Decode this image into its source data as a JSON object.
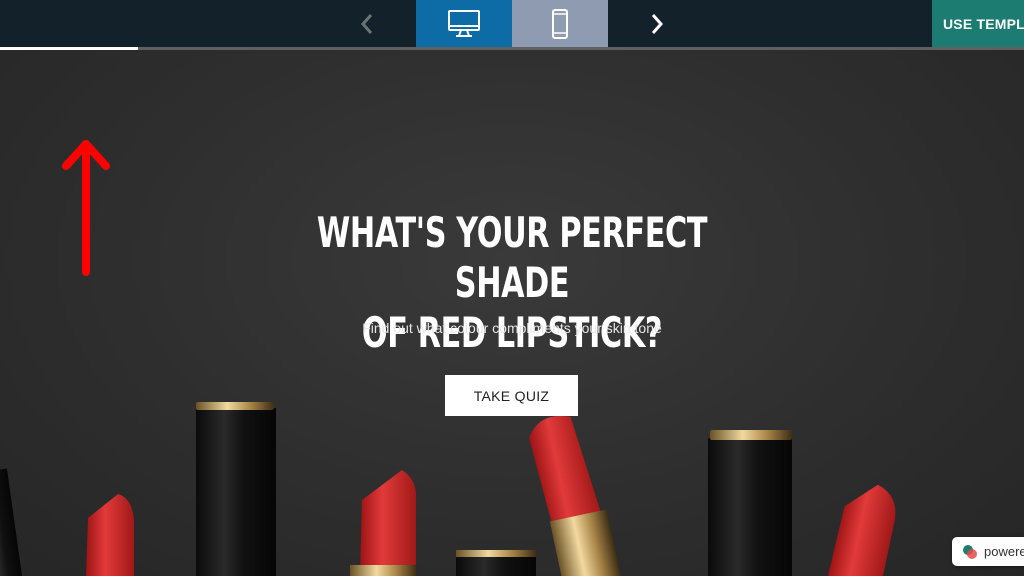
{
  "topbar": {
    "prev_icon": "chevron-left-icon",
    "next_icon": "chevron-right-icon",
    "desktop_icon": "desktop-monitor-icon",
    "mobile_icon": "mobile-phone-icon",
    "use_template_label": "USE TEMPLATE",
    "colors": {
      "bar": "#13212a",
      "desktop_active": "#0d6ca5",
      "mobile": "#8e9bb0",
      "use_template": "#1c7c72"
    }
  },
  "progress": {
    "value": 0.135
  },
  "hero": {
    "headline": "WHAT'S YOUR PERFECT SHADE\nOF RED LIPSTICK?",
    "subtitle": "Find out what colour compliments your skin tone",
    "cta_label": "TAKE QUIZ",
    "annotation_icon": "red-up-arrow-icon",
    "colors": {
      "lipstick": "#d42a2a",
      "annotation": "#ff0000"
    }
  },
  "badge": {
    "label": "powered",
    "icon": "logo-icon"
  }
}
